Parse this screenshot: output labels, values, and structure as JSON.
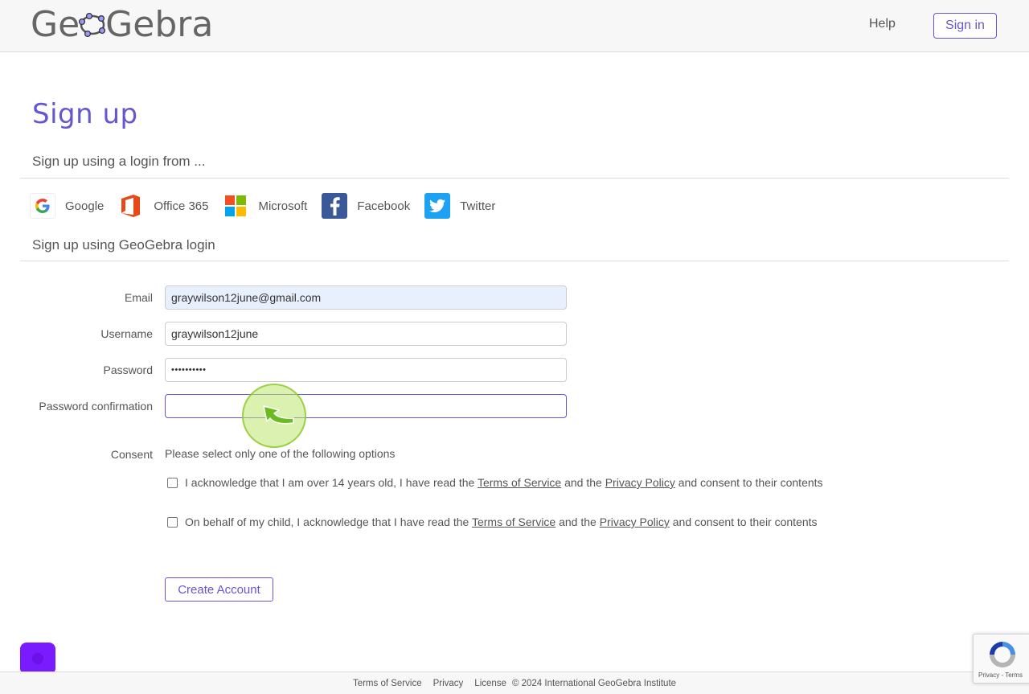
{
  "header": {
    "logo_left": "Ge",
    "logo_right": "Gebra",
    "help_label": "Help",
    "signin_label": "Sign in"
  },
  "page": {
    "title": "Sign up",
    "social_section_title": "Sign up using a login from ...",
    "local_section_title": "Sign up using GeoGebra login"
  },
  "providers": [
    {
      "label": "Google",
      "icon": "google-icon"
    },
    {
      "label": "Office 365",
      "icon": "office365-icon"
    },
    {
      "label": "Microsoft",
      "icon": "microsoft-icon"
    },
    {
      "label": "Facebook",
      "icon": "facebook-icon"
    },
    {
      "label": "Twitter",
      "icon": "twitter-icon"
    }
  ],
  "form": {
    "email_label": "Email",
    "email_value": "graywilson12june@gmail.com",
    "username_label": "Username",
    "username_value": "graywilson12june",
    "password_label": "Password",
    "password_value": "••••••••••",
    "password_confirm_label": "Password confirmation",
    "password_confirm_value": "",
    "consent_label": "Consent",
    "consent_instruction": "Please select only one of the following options",
    "consent_option_adult": {
      "prefix": "I acknowledge that I am over 14 years old, I have read the ",
      "tos": "Terms of Service",
      "middle": " and the ",
      "privacy": "Privacy Policy",
      "suffix": " and consent to their contents"
    },
    "consent_option_child": {
      "prefix": "On behalf of my child, I acknowledge that I have read the ",
      "tos": "Terms of Service",
      "middle": " and the ",
      "privacy": "Privacy Policy",
      "suffix": " and consent to their contents"
    },
    "create_button": "Create Account"
  },
  "footer": {
    "terms": "Terms of Service",
    "privacy": "Privacy",
    "license": "License",
    "copyright": "© 2024 International GeoGebra Institute"
  },
  "recaptcha": {
    "links": "Privacy - Terms"
  },
  "colors": {
    "accent": "#6557d2",
    "chat": "#7a1bff",
    "autofill": "#e8f0fe"
  }
}
